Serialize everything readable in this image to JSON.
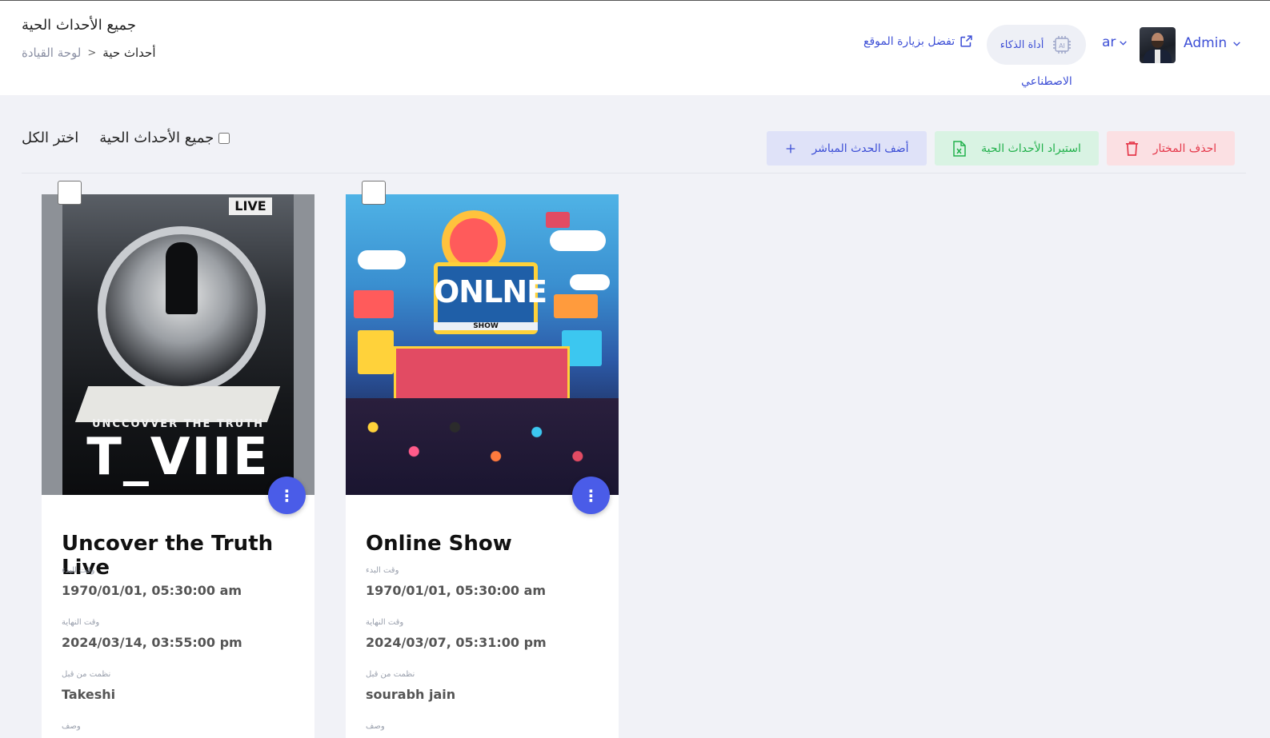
{
  "header": {
    "page_title": "جميع الأحداث الحية",
    "breadcrumb": {
      "current": "أحداث حية",
      "separator": "<",
      "parent": "لوحة القيادة"
    },
    "visit_site": "تفضل بزيارة الموقع",
    "ai_tool": {
      "line1": "أداة الذكاء",
      "line2": "الاصطناعي",
      "icon_text": "AI"
    },
    "language": "ar",
    "user_name": "Admin"
  },
  "toolbar": {
    "select_all": "اختر الكل",
    "all_events": "جميع الأحداث الحية",
    "add_button": "أضف الحدث المباشر",
    "import_button": "استيراد الأحداث الحية",
    "delete_button": "احذف المختار"
  },
  "colors": {
    "accent": "#3d4fd6",
    "success": "#22b14c",
    "danger": "#e5394b",
    "fab": "#4a5ce8"
  },
  "labels": {
    "start_time": "وقت البدء",
    "end_time": "وقت النهاية",
    "organized_by": "نظمت من قبل",
    "description": "وصف"
  },
  "events": [
    {
      "title": "Uncover the Truth Live",
      "start_time": "1970/01/01, 05:30:00 am",
      "end_time": "2024/03/14, 03:55:00 pm",
      "organizer": "Takeshi",
      "poster_text": {
        "line1": "UNCCOVVER THE TRUTH",
        "line2": "T_VIIE",
        "badge": "LIVE"
      }
    },
    {
      "title": "Online Show",
      "start_time": "1970/01/01, 05:30:00 am",
      "end_time": "2024/03/07, 05:31:00 pm",
      "organizer": "sourabh jain",
      "poster_text": {
        "line1": "ONLNE",
        "line2": "SHOW"
      }
    }
  ]
}
